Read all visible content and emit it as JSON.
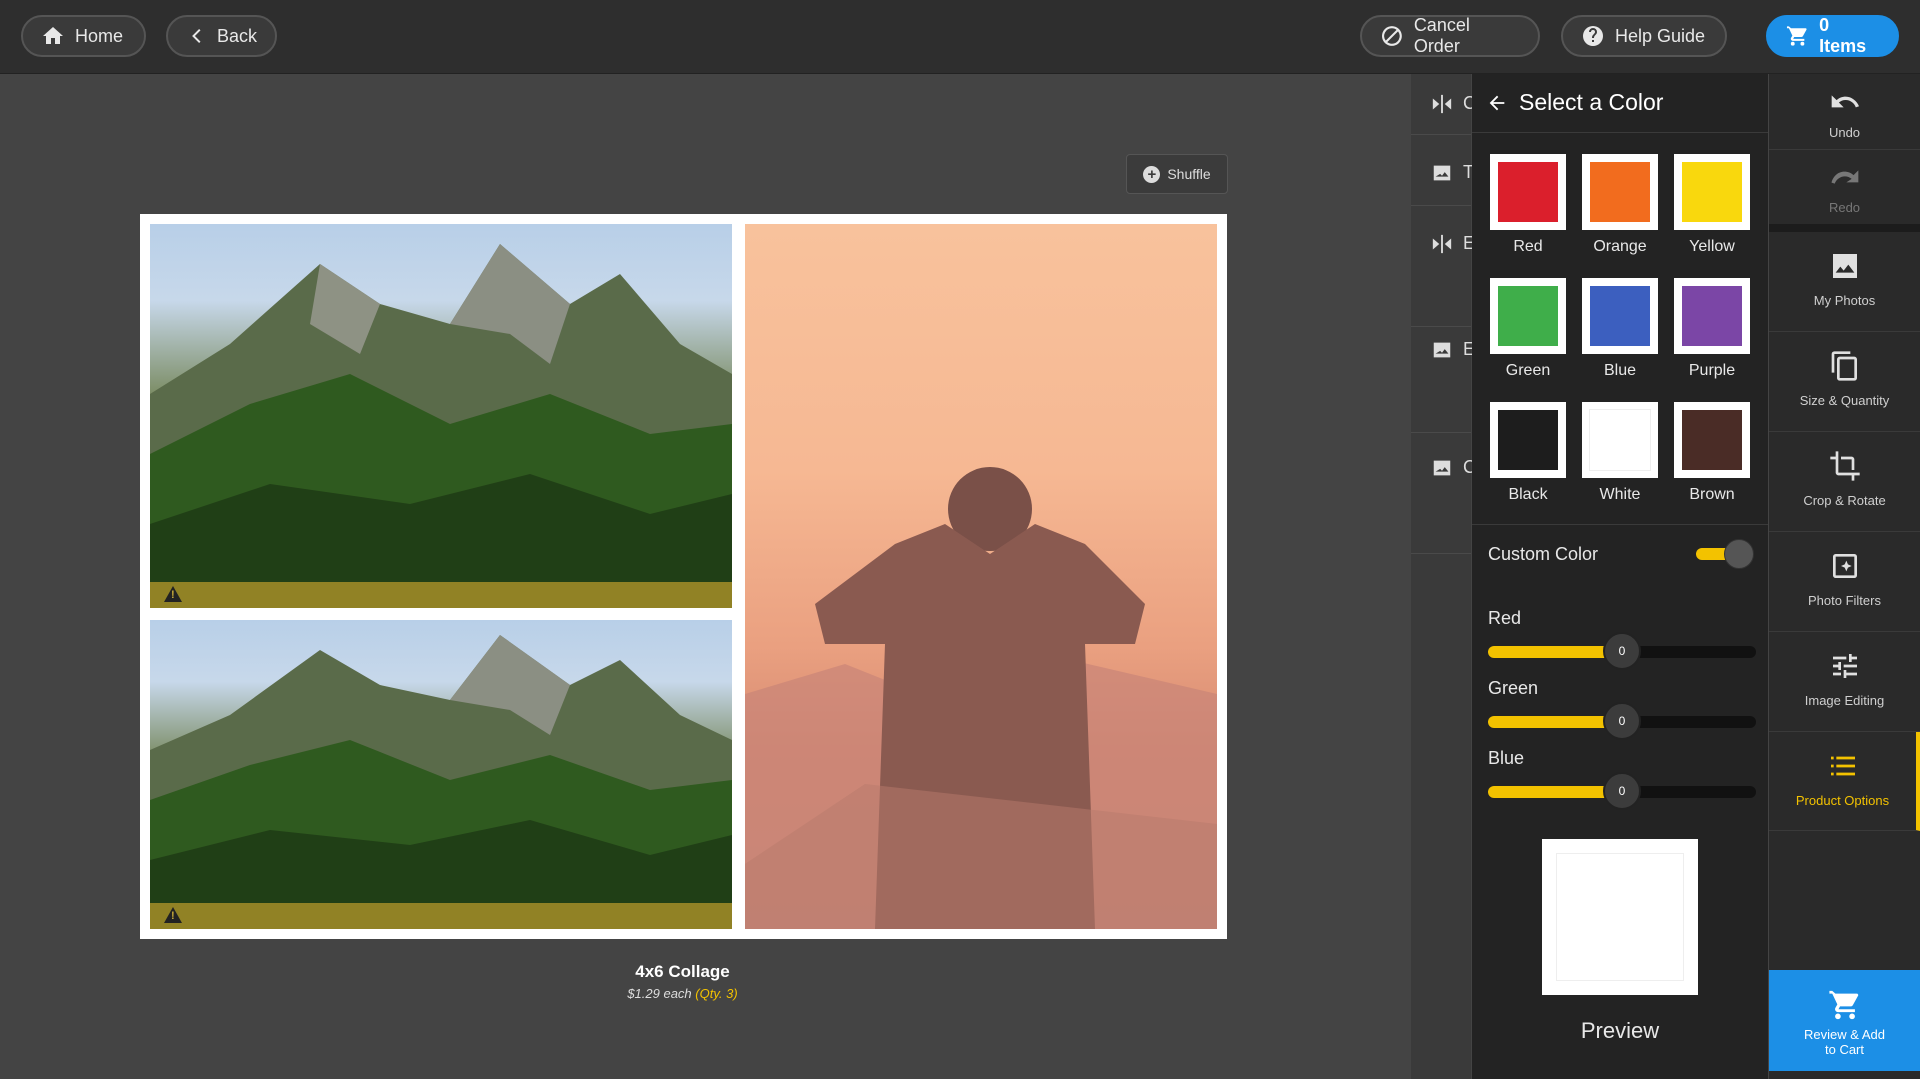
{
  "topbar": {
    "home_label": "Home",
    "back_label": "Back",
    "cancel_label": "Cancel Order",
    "help_label": "Help Guide",
    "cart_label": "0 Items"
  },
  "canvas": {
    "shuffle_label": "Shuffle",
    "product_title": "4x6 Collage",
    "price_text": "$1.29 each",
    "qty_text": "(Qty. 3)"
  },
  "tool_rows": [
    {
      "label": "C",
      "icon": "flip-icon"
    },
    {
      "label": "T",
      "icon": "image-icon"
    },
    {
      "label": "E",
      "icon": "flip-icon"
    },
    {
      "label": "E",
      "icon": "image-icon"
    },
    {
      "label": "C",
      "icon": "image-icon"
    }
  ],
  "color_panel": {
    "title": "Select a Color",
    "swatches": [
      {
        "name": "Red",
        "color": "#db1f2c"
      },
      {
        "name": "Orange",
        "color": "#f26c1e"
      },
      {
        "name": "Yellow",
        "color": "#f9d80d"
      },
      {
        "name": "Green",
        "color": "#3fae4a"
      },
      {
        "name": "Blue",
        "color": "#3c5fbf"
      },
      {
        "name": "Purple",
        "color": "#7b46a6"
      },
      {
        "name": "Black",
        "color": "#1d1d1d"
      },
      {
        "name": "White",
        "color": "#ffffff"
      },
      {
        "name": "Brown",
        "color": "#4a2c26"
      }
    ],
    "custom_color_label": "Custom Color",
    "custom_color_enabled": true,
    "sliders": [
      {
        "label": "Red",
        "value": "0",
        "fill": 0.5
      },
      {
        "label": "Green",
        "value": "0",
        "fill": 0.5
      },
      {
        "label": "Blue",
        "value": "0",
        "fill": 0.5
      }
    ],
    "preview_label": "Preview"
  },
  "sidebar": {
    "undo": "Undo",
    "redo": "Redo",
    "my_photos": "My Photos",
    "size_quantity": "Size & Quantity",
    "crop_rotate": "Crop & Rotate",
    "photo_filters": "Photo Filters",
    "image_editing": "Image Editing",
    "product_options": "Product Options",
    "review_cart_line1": "Review & Add",
    "review_cart_line2": "to Cart"
  },
  "colors": {
    "accent": "#f3c200",
    "cart_blue": "#1c8fe6"
  }
}
